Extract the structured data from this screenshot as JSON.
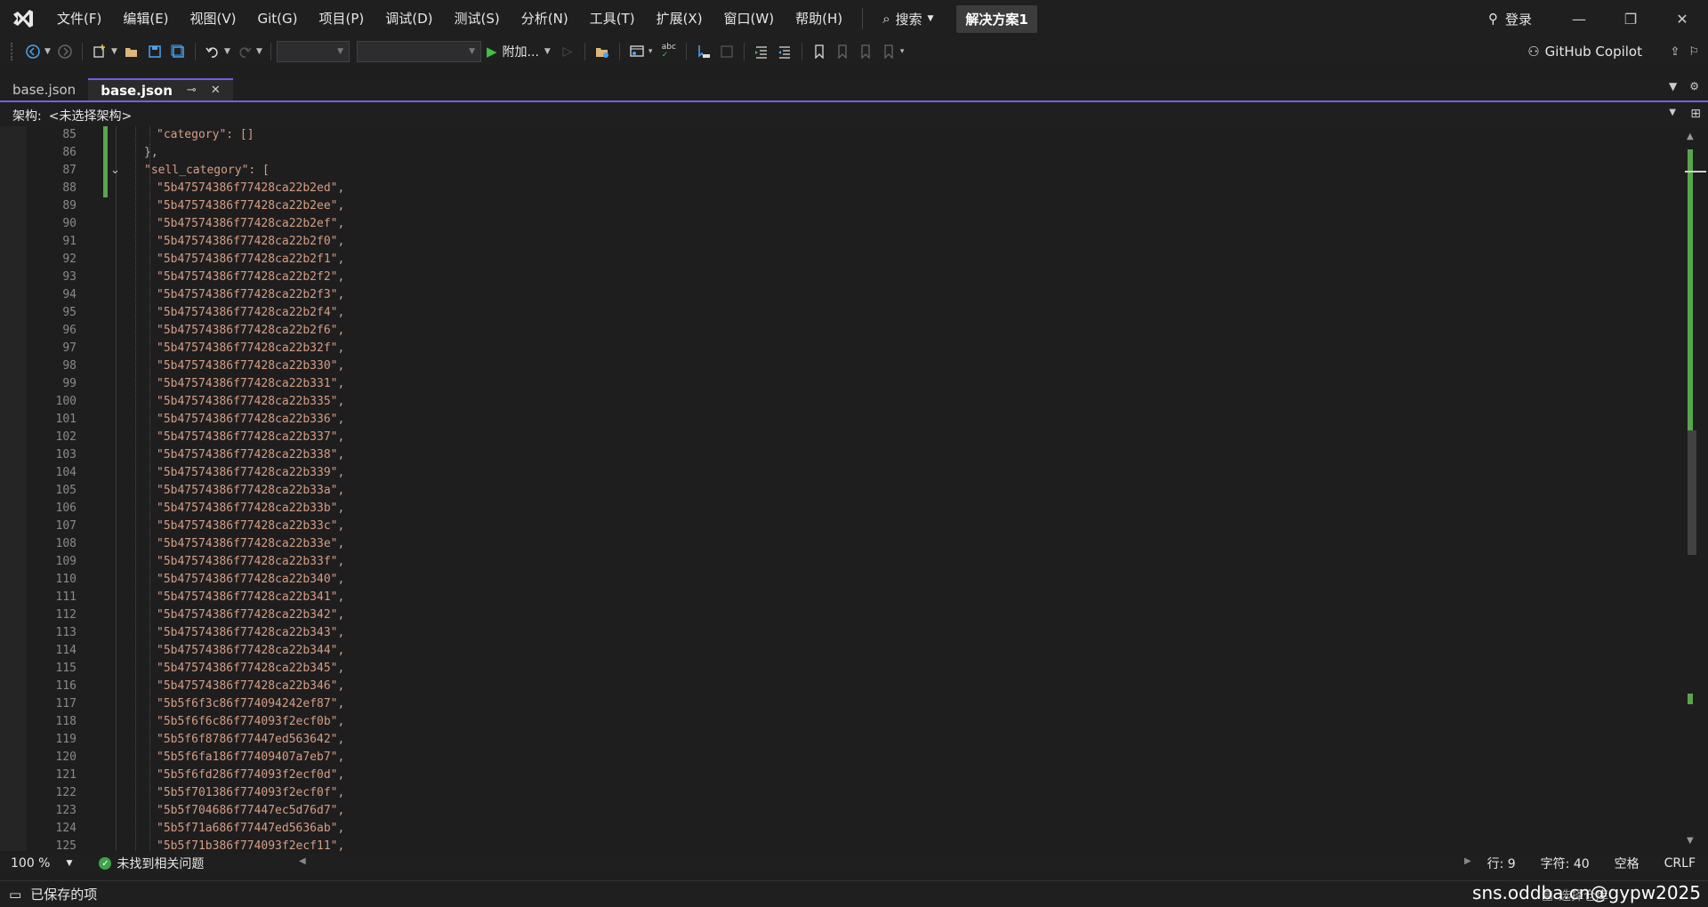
{
  "window": {
    "menus": [
      "文件(F)",
      "编辑(E)",
      "视图(V)",
      "Git(G)",
      "项目(P)",
      "调试(D)",
      "测试(S)",
      "分析(N)",
      "工具(T)",
      "扩展(X)",
      "窗口(W)",
      "帮助(H)"
    ],
    "search_label": "搜索",
    "solution_name": "解决方案1",
    "login_label": "登录"
  },
  "toolbar": {
    "attach_label": "附加...",
    "copilot_label": "GitHub Copilot"
  },
  "tabs": [
    {
      "label": "base.json",
      "active": false
    },
    {
      "label": "base.json",
      "active": true
    }
  ],
  "framework_bar": {
    "label": "架构:",
    "value": "<未选择架构>"
  },
  "editor": {
    "line_numbers": [
      "85",
      "86",
      "87",
      "88",
      "89",
      "90",
      "91",
      "92",
      "93",
      "94",
      "95",
      "96",
      "97",
      "98",
      "99",
      "100",
      "101",
      "102",
      "103",
      "104",
      "105",
      "106",
      "107",
      "108",
      "109",
      "110",
      "111",
      "112",
      "113",
      "114",
      "115",
      "116",
      "117",
      "118",
      "119",
      "120",
      "121",
      "122",
      "123",
      "124",
      "125"
    ],
    "lines": [
      "\"category\": []",
      "},",
      "\"sell_category\": [",
      "\"5b47574386f77428ca22b2ed\",",
      "\"5b47574386f77428ca22b2ee\",",
      "\"5b47574386f77428ca22b2ef\",",
      "\"5b47574386f77428ca22b2f0\",",
      "\"5b47574386f77428ca22b2f1\",",
      "\"5b47574386f77428ca22b2f2\",",
      "\"5b47574386f77428ca22b2f3\",",
      "\"5b47574386f77428ca22b2f4\",",
      "\"5b47574386f77428ca22b2f6\",",
      "\"5b47574386f77428ca22b32f\",",
      "\"5b47574386f77428ca22b330\",",
      "\"5b47574386f77428ca22b331\",",
      "\"5b47574386f77428ca22b335\",",
      "\"5b47574386f77428ca22b336\",",
      "\"5b47574386f77428ca22b337\",",
      "\"5b47574386f77428ca22b338\",",
      "\"5b47574386f77428ca22b339\",",
      "\"5b47574386f77428ca22b33a\",",
      "\"5b47574386f77428ca22b33b\",",
      "\"5b47574386f77428ca22b33c\",",
      "\"5b47574386f77428ca22b33e\",",
      "\"5b47574386f77428ca22b33f\",",
      "\"5b47574386f77428ca22b340\",",
      "\"5b47574386f77428ca22b341\",",
      "\"5b47574386f77428ca22b342\",",
      "\"5b47574386f77428ca22b343\",",
      "\"5b47574386f77428ca22b344\",",
      "\"5b47574386f77428ca22b345\",",
      "\"5b47574386f77428ca22b346\",",
      "\"5b5f6f3c86f774094242ef87\",",
      "\"5b5f6f6c86f774093f2ecf0b\",",
      "\"5b5f6f8786f77447ed563642\",",
      "\"5b5f6fa186f77409407a7eb7\",",
      "\"5b5f6fd286f774093f2ecf0d\",",
      "\"5b5f701386f774093f2ecf0f\",",
      "\"5b5f704686f77447ec5d76d7\",",
      "\"5b5f71a686f77447ed5636ab\",",
      "\"5b5f71b386f774093f2ecf11\","
    ],
    "indent_levels": [
      2,
      1,
      1,
      2,
      2,
      2,
      2,
      2,
      2,
      2,
      2,
      2,
      2,
      2,
      2,
      2,
      2,
      2,
      2,
      2,
      2,
      2,
      2,
      2,
      2,
      2,
      2,
      2,
      2,
      2,
      2,
      2,
      2,
      2,
      2,
      2,
      2,
      2,
      2,
      2,
      2
    ]
  },
  "status": {
    "zoom": "100 %",
    "issues": "未找到相关问题",
    "line": "行: 9",
    "char": "字符: 40",
    "spaces": "空格",
    "eol": "CRLF"
  },
  "app_status": {
    "saved": "已保存的项",
    "source_control": "选择仓库",
    "watermark": "sns.oddba.cn@gypw2025"
  },
  "colors": {
    "accent": "#7160e8",
    "string": "#d69d85",
    "change_bar": "#57a64a"
  }
}
